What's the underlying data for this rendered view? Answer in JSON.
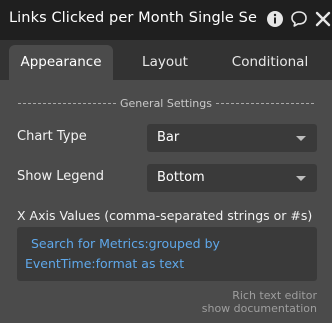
{
  "header": {
    "title": "Links Clicked per Month Single Se",
    "icons": [
      "info-icon",
      "comment-icon",
      "close-icon"
    ]
  },
  "tabs": [
    {
      "label": "Appearance",
      "active": true
    },
    {
      "label": "Layout",
      "active": false
    },
    {
      "label": "Conditional",
      "active": false
    }
  ],
  "section": {
    "title": "General Settings"
  },
  "fields": {
    "chart_type": {
      "label": "Chart Type",
      "value": "Bar"
    },
    "show_legend": {
      "label": "Show Legend",
      "value": "Bottom"
    },
    "x_axis": {
      "label": "X Axis Values (comma-separated strings or #s)",
      "expression": "Search for Metrics:grouped by EventTime:format as text"
    }
  },
  "footer": {
    "rich_text_editor": "Rich text editor",
    "show_documentation": "show documentation"
  },
  "colors": {
    "accent_link": "#5fa8ea",
    "panel_bg": "#4b4b4b",
    "titlebar_bg": "#1f1f1f"
  }
}
